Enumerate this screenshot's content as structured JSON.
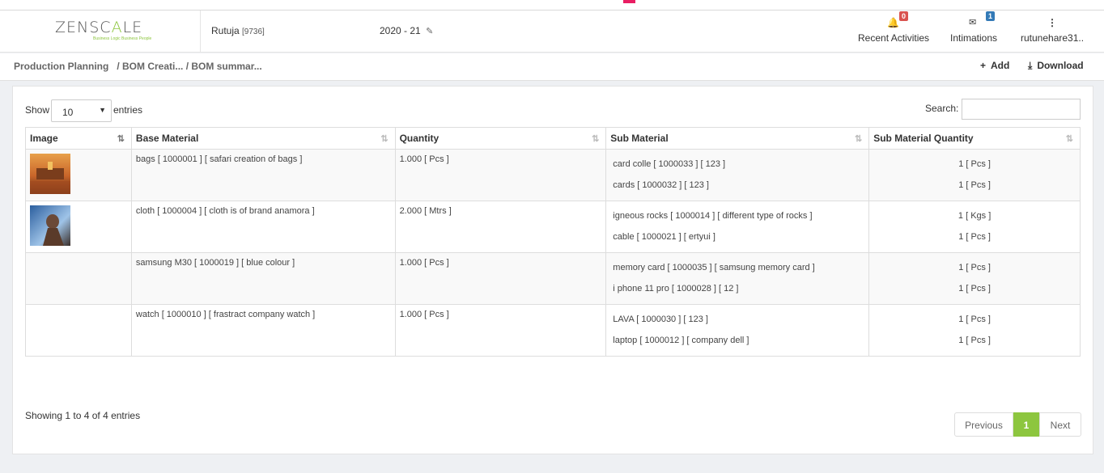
{
  "header": {
    "logo_prefix": "ZENSC",
    "logo_accent": "A",
    "logo_suffix": "LE",
    "logo_tagline": "Business Logic Business People",
    "user_name": "Rutuja",
    "user_id": "[9736]",
    "year": "2020 - 21",
    "recent_activities": {
      "label": "Recent Activities",
      "count": "0"
    },
    "intimations": {
      "label": "Intimations",
      "count": "1"
    },
    "account": {
      "label": "rutunehare31.."
    }
  },
  "breadcrumb": {
    "root": "Production Planning",
    "rest": "/ BOM Creati... / BOM summar..."
  },
  "toolbar": {
    "add_label": "Add",
    "download_label": "Download"
  },
  "table_controls": {
    "show_label": "Show",
    "page_size": "10",
    "entries_label": "entries",
    "search_label": "Search:"
  },
  "table": {
    "columns": [
      "Image",
      "Base Material",
      "Quantity",
      "Sub Material",
      "Sub Material Quantity"
    ],
    "rows": [
      {
        "base": "bags [ 1000001 ] [ safari creation of bags ]",
        "qty": "1.000 [ Pcs ]",
        "subs": [
          {
            "name": "card colle [ 1000033 ] [ 123 ]",
            "qty": "1 [ Pcs ]"
          },
          {
            "name": "cards [ 1000032 ] [ 123 ]",
            "qty": "1 [ Pcs ]"
          }
        ]
      },
      {
        "base": "cloth [ 1000004 ] [ cloth is of brand anamora ]",
        "qty": "2.000 [ Mtrs ]",
        "subs": [
          {
            "name": "igneous rocks [ 1000014 ] [ different type of rocks ]",
            "qty": "1 [ Kgs ]"
          },
          {
            "name": "cable [ 1000021 ] [ ertyui ]",
            "qty": "1 [ Pcs ]"
          }
        ]
      },
      {
        "base": "samsung M30 [ 1000019 ] [ blue colour ]",
        "qty": "1.000 [ Pcs ]",
        "subs": [
          {
            "name": "memory card [ 1000035 ] [ samsung memory card ]",
            "qty": "1 [ Pcs ]"
          },
          {
            "name": "i phone 11 pro [ 1000028 ] [ 12 ]",
            "qty": "1 [ Pcs ]"
          }
        ]
      },
      {
        "base": "watch [ 1000010 ] [ frastract company watch ]",
        "qty": "1.000 [ Pcs ]",
        "subs": [
          {
            "name": "LAVA [ 1000030 ] [ 123 ]",
            "qty": "1 [ Pcs ]"
          },
          {
            "name": "laptop [ 1000012 ] [ company dell ]",
            "qty": "1 [ Pcs ]"
          }
        ]
      }
    ]
  },
  "footer": {
    "info": "Showing 1 to 4 of 4 entries",
    "prev_label": "Previous",
    "current_page": "1",
    "next_label": "Next"
  },
  "colors": {
    "accent": "#8dc63f",
    "badge_red": "#d9534f",
    "badge_blue": "#337ab7",
    "background": "#eef0f3"
  }
}
